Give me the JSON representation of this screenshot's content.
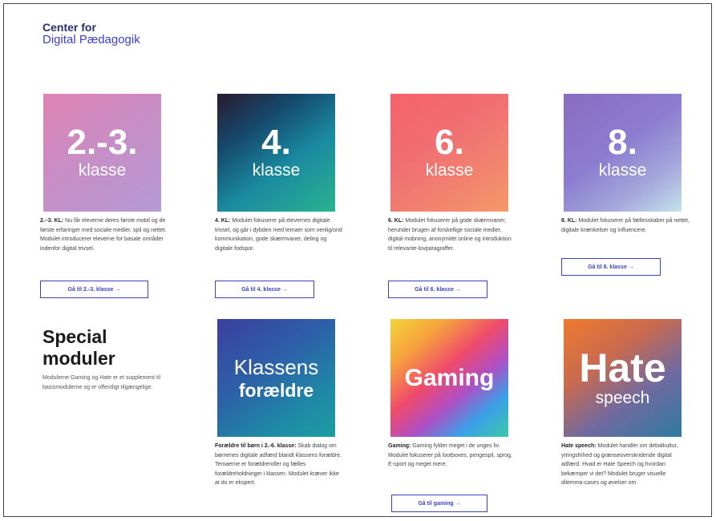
{
  "logo": {
    "line1": "Center for",
    "line2": "Digital Pædagogik"
  },
  "grades": [
    {
      "big": "2.-3.",
      "small": "klasse",
      "desc_bold": "2.–3. KL:",
      "desc": "Nu får eleverne deres første mobil og de første erfaringer med sociale medier, spil og nettet. Modulet introducerer eleverne for basale områder indenfor digital trivsel.",
      "button": "Gå til 2.-3. klasse →"
    },
    {
      "big": "4.",
      "small": "klasse",
      "desc_bold": "4. KL:",
      "desc": "Modulet fokuserer på elevernes digitale trivsel, og går i dybden med temaer som venlig/ond kommunikation, gode skærmvaner, deling og digitale fodspor.",
      "button": "Gå til 4. klasse →"
    },
    {
      "big": "6.",
      "small": "klasse",
      "desc_bold": "6. KL:",
      "desc": "Modulet fokuserer på gode skærmvaner, herunder brugen af forskellige sociale medier, digital mobning, anonymitet online og introduktion til relevante lovparagraffer.",
      "button": "Gå til 6. klasse →"
    },
    {
      "big": "8.",
      "small": "klasse",
      "desc_bold": "8. KL:",
      "desc": "Modulet fokuserer på fællesskaber på nettet, digitale krænkelser og influencere.",
      "button": "Gå til 8. klasse →"
    }
  ],
  "special": {
    "title_line1": "Special",
    "title_line2": "moduler",
    "desc": "Modulerne Gaming og Hate er et supplement til basismodulerne og er offentligt tilgængelige."
  },
  "modules": [
    {
      "word1": "Klassens",
      "word2": "forældre",
      "desc_bold": "Forældre til børn i 2.-6. klasse:",
      "desc": "Skab dialog om børnenes digitale adfærd blandt klassens forældre. Temaerne er forældreroller og fælles forældreholdninger i klassen. Modulet kræver ikke at du er ekspert."
    },
    {
      "word1": "Gaming",
      "desc_bold": "Gaming:",
      "desc": "Gaming fylder meget i de unges liv. Modulet fokuserer på lootboxes, pengespil, sprog, E-sport og meget mere.",
      "button": "Gå til gaming →"
    },
    {
      "word1": "Hate",
      "word2": "speech",
      "desc_bold": "Hate speech:",
      "desc": "Modulet handler om debatkultur, ytringsfrihed og grænseoverskridende digital adfærd. Hvad er Hate Speech og hvordan bekæmper vi det? Modulet bruger visuelle dilemma-cases og øvelser om"
    }
  ]
}
